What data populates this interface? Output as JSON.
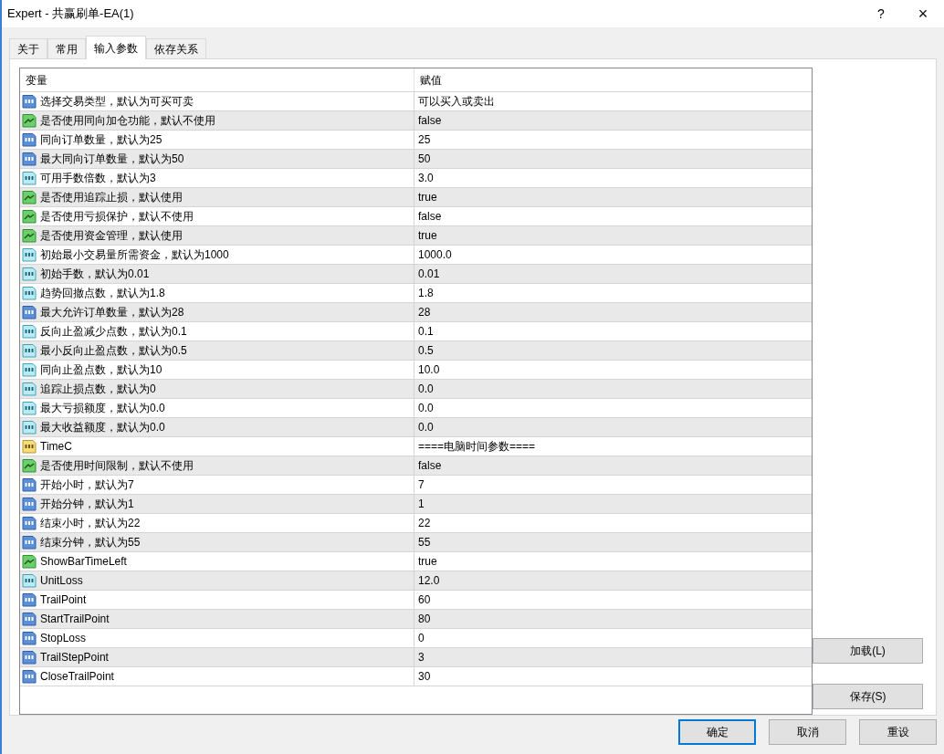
{
  "window": {
    "title": "Expert - 共赢刷单-EA(1)",
    "help": "?",
    "close": "×"
  },
  "tabs": [
    {
      "label": "关于",
      "selected": false
    },
    {
      "label": "常用",
      "selected": false
    },
    {
      "label": "输入参数",
      "selected": true
    },
    {
      "label": "依存关系",
      "selected": false
    }
  ],
  "table": {
    "columns": [
      "变量",
      "赋值"
    ],
    "rows": [
      {
        "kind": "int",
        "name": "选择交易类型，默认为可买可卖",
        "value": "可以买入或卖出"
      },
      {
        "kind": "bool",
        "name": "是否使用同向加仓功能，默认不使用",
        "value": "false"
      },
      {
        "kind": "int",
        "name": "同向订单数量，默认为25",
        "value": "25"
      },
      {
        "kind": "int",
        "name": "最大同向订单数量，默认为50",
        "value": "50"
      },
      {
        "kind": "double",
        "name": "可用手数倍数，默认为3",
        "value": "3.0"
      },
      {
        "kind": "bool",
        "name": "是否使用追踪止损，默认使用",
        "value": "true"
      },
      {
        "kind": "bool",
        "name": "是否使用亏损保护，默认不使用",
        "value": "false"
      },
      {
        "kind": "bool",
        "name": "是否使用资金管理，默认使用",
        "value": "true"
      },
      {
        "kind": "double",
        "name": "初始最小交易量所需资金，默认为1000",
        "value": "1000.0"
      },
      {
        "kind": "double",
        "name": "初始手数，默认为0.01",
        "value": "0.01"
      },
      {
        "kind": "double",
        "name": "趋势回撤点数，默认为1.8",
        "value": "1.8"
      },
      {
        "kind": "int",
        "name": "最大允许订单数量，默认为28",
        "value": "28"
      },
      {
        "kind": "double",
        "name": "反向止盈减少点数，默认为0.1",
        "value": "0.1"
      },
      {
        "kind": "double",
        "name": "最小反向止盈点数，默认为0.5",
        "value": "0.5"
      },
      {
        "kind": "double",
        "name": "同向止盈点数，默认为10",
        "value": "10.0"
      },
      {
        "kind": "double",
        "name": "追踪止损点数，默认为0",
        "value": "0.0"
      },
      {
        "kind": "double",
        "name": "最大亏损额度，默认为0.0",
        "value": "0.0"
      },
      {
        "kind": "double",
        "name": "最大收益额度，默认为0.0",
        "value": "0.0"
      },
      {
        "kind": "string",
        "name": "TimeC",
        "value": "====电脑时间参数===="
      },
      {
        "kind": "bool",
        "name": "是否使用时间限制，默认不使用",
        "value": "false"
      },
      {
        "kind": "int",
        "name": "开始小时，默认为7",
        "value": "7"
      },
      {
        "kind": "int",
        "name": "开始分钟，默认为1",
        "value": "1"
      },
      {
        "kind": "int",
        "name": "结束小时，默认为22",
        "value": "22"
      },
      {
        "kind": "int",
        "name": "结束分钟，默认为55",
        "value": "55"
      },
      {
        "kind": "bool",
        "name": "ShowBarTimeLeft",
        "value": "true"
      },
      {
        "kind": "double",
        "name": "UnitLoss",
        "value": "12.0"
      },
      {
        "kind": "int",
        "name": "TrailPoint",
        "value": "60"
      },
      {
        "kind": "int",
        "name": "StartTrailPoint",
        "value": "80"
      },
      {
        "kind": "int",
        "name": "StopLoss",
        "value": "0"
      },
      {
        "kind": "int",
        "name": "TrailStepPoint",
        "value": "3"
      },
      {
        "kind": "int",
        "name": "CloseTrailPoint",
        "value": "30"
      }
    ]
  },
  "side_buttons": [
    "加载(L)",
    "保存(S)"
  ],
  "buttons": [
    {
      "label": "确定",
      "default": true
    },
    {
      "label": "取消",
      "default": false
    },
    {
      "label": "重设",
      "default": false
    }
  ]
}
